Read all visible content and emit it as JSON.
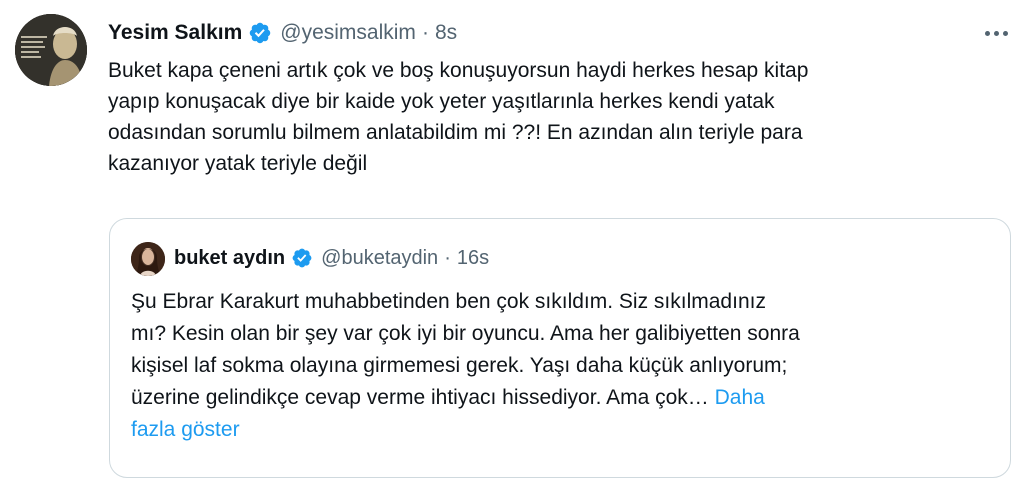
{
  "tweet": {
    "author_name": "Yesim Salkım",
    "handle": "@yesimsalkim",
    "separator": "·",
    "time": "8s",
    "text_lines": [
      "Buket kapa çeneni artık çok ve boş konuşuyorsun haydi herkes hesap kitap",
      "yapıp konuşacak diye bir kaide yok yeter yaşıtlarınla herkes kendi yatak",
      "odasından sorumlu bilmem anlatabildim mi ??! En azından alın teriyle para",
      "kazanıyor yatak teriyle değil"
    ]
  },
  "quoted": {
    "author_name": "buket aydın",
    "handle": "@buketaydin",
    "separator": "·",
    "time": "16s",
    "text_lines": [
      "Şu Ebrar Karakurt muhabbetinden ben çok sıkıldım. Siz sıkılmadınız",
      "mı? Kesin olan bir şey var çok iyi bir oyuncu. Ama her galibiyetten sonra",
      "kişisel laf sokma olayına girmemesi gerek. Yaşı daha küçük anlıyorum;",
      "üzerine gelindikçe cevap verme ihtiyacı hissediyor. Ama çok…",
      "fazla göster"
    ],
    "show_more_first": "Daha"
  },
  "icons": {
    "verified": "verified-badge-icon",
    "more": "more-options-icon"
  },
  "colors": {
    "text": "#0f1419",
    "secondary": "#536471",
    "accent": "#1d9bf0",
    "border": "#cfd9de"
  }
}
